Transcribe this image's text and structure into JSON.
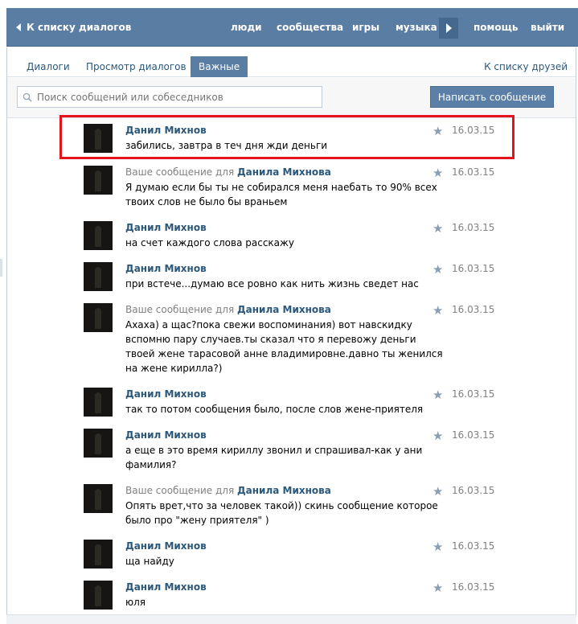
{
  "header": {
    "back_label": "К списку диалогов",
    "nav": [
      "люди",
      "сообщества",
      "игры",
      "музыка",
      "помощь",
      "выйти"
    ]
  },
  "tabs": {
    "items": [
      "Диалоги",
      "Просмотр диалогов",
      "Важные"
    ],
    "active": "Важные",
    "friends_link": "К списку друзей"
  },
  "search": {
    "placeholder": "Поиск сообщений или собеседников",
    "write_button": "Написать сообщение"
  },
  "colors": {
    "header_bg": "#597da3",
    "link": "#2b587a",
    "highlight": "#e4131c"
  },
  "messages": [
    {
      "prefix": "",
      "name": "Данил Михнов",
      "date": "16.03.15",
      "text": "забились, завтра в теч дня жди деньги"
    },
    {
      "prefix": "Ваше сообщение для ",
      "name": "Данила Михнова",
      "date": "16.03.15",
      "text": "Я думаю если бы ты не собирался меня наебать то 90% всех твоих слов не было бы враньем"
    },
    {
      "prefix": "",
      "name": "Данил Михнов",
      "date": "16.03.15",
      "text": "на счет каждого слова расскажу"
    },
    {
      "prefix": "",
      "name": "Данил Михнов",
      "date": "16.03.15",
      "text": "при встече...думаю все ровно как нить жизнь сведет нас"
    },
    {
      "prefix": "Ваше сообщение для ",
      "name": "Данила Михнова",
      "date": "16.03.15",
      "text": "Ахаха) а щас?пока свежи воспоминания) вот навскидку вспомню пару случаев.ты сказал что я перевожу деньги твоей жене тарасовой анне владимировне.давно ты женился на жене кирилла?)"
    },
    {
      "prefix": "",
      "name": "Данил Михнов",
      "date": "16.03.15",
      "text": "так то потом сообщения было, после слов жене-приятеля"
    },
    {
      "prefix": "",
      "name": "Данил Михнов",
      "date": "16.03.15",
      "text": "а еще в это время кириллу звонил и спрашивал-как у ани фамилия?"
    },
    {
      "prefix": "Ваше сообщение для ",
      "name": "Данила Михнова",
      "date": "16.03.15",
      "text": "Опять врет,что за человек такой)) скинь сообщение которое было про \"жену приятеля\" )"
    },
    {
      "prefix": "",
      "name": "Данил Михнов",
      "date": "16.03.15",
      "text": "ща найду"
    },
    {
      "prefix": "",
      "name": "Данил Михнов",
      "date": "16.03.15",
      "text": "юля"
    }
  ]
}
